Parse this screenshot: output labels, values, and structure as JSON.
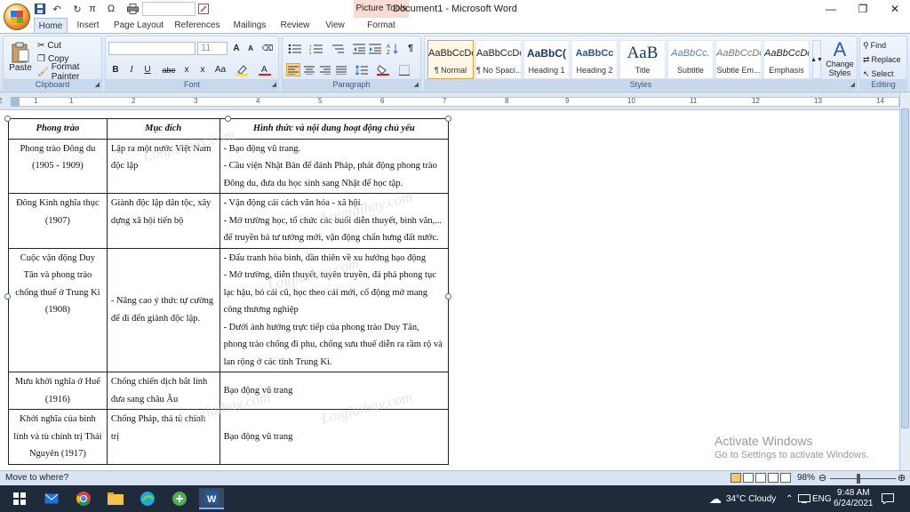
{
  "titlebar": {
    "title": "Document1 - Microsoft Word",
    "contextual_tab": "Picture Tools",
    "minimize": "—",
    "restore": "❐",
    "close": "✕"
  },
  "qat": {
    "save_icon": "save-icon",
    "undo": "↶",
    "redo": "↻",
    "pi": "π",
    "omega": "Ω"
  },
  "tabs": [
    {
      "label": "Home",
      "active": true
    },
    {
      "label": "Insert"
    },
    {
      "label": "Page Layout"
    },
    {
      "label": "References"
    },
    {
      "label": "Mailings"
    },
    {
      "label": "Review"
    },
    {
      "label": "View"
    },
    {
      "label": "Format"
    }
  ],
  "ribbon": {
    "clipboard": {
      "label": "Clipboard",
      "paste": "Paste",
      "cut": "Cut",
      "copy": "Copy",
      "format_painter": "Format Painter"
    },
    "font": {
      "label": "Font",
      "font_name": "",
      "font_size": "11",
      "grow": "A",
      "shrink": "A",
      "bold": "B",
      "italic": "I",
      "underline": "U",
      "strike": "abe",
      "subscript": "x",
      "superscript": "x",
      "case": "Aa"
    },
    "paragraph": {
      "label": "Paragraph",
      "pilcrow": "¶"
    },
    "styles": {
      "label": "Styles",
      "items": [
        {
          "sample": "AaBbCcDc",
          "name": "¶ Normal",
          "selected": true
        },
        {
          "sample": "AaBbCcDc",
          "name": "¶ No Spaci..."
        },
        {
          "sample": "AaBbC(",
          "name": "Heading 1"
        },
        {
          "sample": "AaBbCc",
          "name": "Heading 2"
        },
        {
          "sample": "AaB",
          "name": "Title"
        },
        {
          "sample": "AaBbCc.",
          "name": "Subtitle"
        },
        {
          "sample": "AaBbCcDc",
          "name": "Subtle Em..."
        },
        {
          "sample": "AaBbCcDc",
          "name": "Emphasis"
        }
      ],
      "change_styles": "Change Styles"
    },
    "editing": {
      "label": "Editing",
      "find": "Find",
      "replace": "Replace",
      "select": "Select"
    }
  },
  "ruler": {
    "numbers": [
      "1",
      "2",
      "1",
      "2",
      "3",
      "4",
      "5",
      "6",
      "7",
      "8",
      "9",
      "10",
      "11",
      "12",
      "13",
      "14"
    ]
  },
  "table": {
    "headers": [
      "Phong trào",
      "Mục đích",
      "Hình thức và nội dung hoạt động chủ yếu"
    ],
    "rows": [
      {
        "c1": "Phong trào Đông du (1905 - 1909)",
        "c2": "Lập ra một nước Việt Nam độc lập",
        "c3": [
          "- Bạo động vũ trang.",
          "- Cầu viện Nhật Bản để đánh Pháp, phát động phong trào Đông du, đưa du học sinh sang Nhật để học tập."
        ]
      },
      {
        "c1": "Đông Kinh nghĩa thục (1907)",
        "c2": "Giành độc lập dân tộc, xây dựng xã hội tiến bộ",
        "c3": [
          "- Vận động cải cách văn hóa - xã hội.",
          "- Mở trường học, tổ chức các buổi diễn thuyết, bình văn,... để truyền bá tư tưởng mới, vận động chấn hưng đất nước."
        ]
      },
      {
        "c1": "Cuộc vận động Duy Tân và phong trào chống thuế ở Trung Kì (1908)",
        "c2": "- Nâng cao ý thức tự cường để đi đến giành độc lập.",
        "c3": [
          "- Đấu tranh hòa bình, dần thiên về xu hướng bạo động",
          "- Mở trường, diễn thuyết, tuyên truyền, đả phá phong tục lạc hậu, bỏ cái cũ, học theo cái mới, cổ động mở mang công thương nghiệp",
          "- Dưới ảnh hưởng trực tiếp của phong trào Duy Tân, phong trào chống đi phu, chống sưu thuế diễn ra rầm rộ và lan rộng ở các tỉnh Trung Kì."
        ]
      },
      {
        "c1": "Mưu khởi nghĩa ở Huế (1916)",
        "c2": "Chống chiến dịch bắt lính đưa sang châu Âu",
        "c3": [
          "Bạo động vũ trang"
        ]
      },
      {
        "c1": "Khởi nghĩa của binh lính và tù chính trị Thái Nguyên (1917)",
        "c2": "Chống Pháp, thả tù chính trị",
        "c3": [
          "Bạo động vũ trang"
        ]
      }
    ],
    "watermark": "Loigiaihay.com"
  },
  "activate": {
    "title": "Activate Windows",
    "subtitle": "Go to Settings to activate Windows."
  },
  "statusbar": {
    "message": "Move to where?",
    "zoom": "98%"
  },
  "taskbar": {
    "weather": "34°C  Cloudy",
    "lang": "ENG",
    "time": "9:48 AM",
    "date": "6/24/2021"
  }
}
